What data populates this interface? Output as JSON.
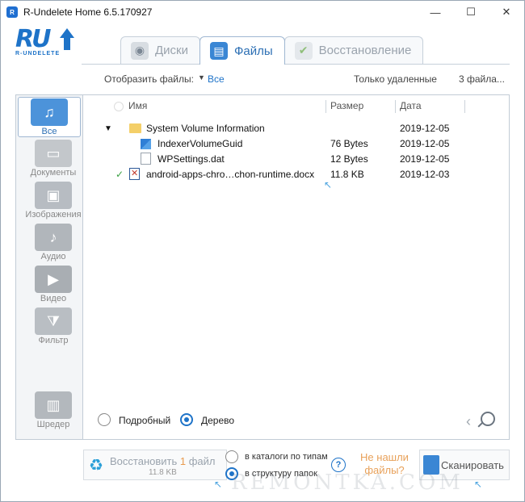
{
  "window": {
    "title": "R-Undelete Home 6.5.170927",
    "icon_text": "R",
    "controls": [
      "—",
      "☐",
      "✕"
    ]
  },
  "logo": {
    "mark": "RU",
    "subtext": "R-UNDELETE"
  },
  "tabs": [
    {
      "label": "Диски",
      "icon": "disk-icon",
      "active": false
    },
    {
      "label": "Файлы",
      "icon": "files-icon",
      "active": true
    },
    {
      "label": "Восстановление",
      "icon": "restore-icon",
      "active": false
    }
  ],
  "filterbar": {
    "show_label": "Отобразить файлы:",
    "caret": "▼",
    "show_value": "Все",
    "only_deleted": "Только удаленные",
    "count": "3 файла..."
  },
  "categories": [
    {
      "label": "Все",
      "icon": "all-files-icon"
    },
    {
      "label": "Документы",
      "icon": "documents-icon"
    },
    {
      "label": "Изображения",
      "icon": "images-icon"
    },
    {
      "label": "Аудио",
      "icon": "audio-icon"
    },
    {
      "label": "Видео",
      "icon": "video-icon"
    },
    {
      "label": "Фильтр",
      "icon": "filter-icon"
    },
    {
      "label": "Шредер",
      "icon": "shredder-icon"
    }
  ],
  "columns": {
    "name": "Имя",
    "size": "Размер",
    "date": "Дата"
  },
  "rows": [
    {
      "expander": "▼",
      "name": "System Volume Information",
      "size": "",
      "date": "2019-12-05"
    },
    {
      "name": "IndexerVolumeGuid",
      "size": "76 Bytes",
      "date": "2019-12-05"
    },
    {
      "name": "WPSettings.dat",
      "size": "12 Bytes",
      "date": "2019-12-05"
    },
    {
      "check": "✓",
      "name": "android-apps-chro…chon-runtime.docx",
      "size": "11.8 KB",
      "date": "2019-12-03"
    }
  ],
  "viewmode": {
    "detailed": "Подробный",
    "tree": "Дерево",
    "selected": "tree"
  },
  "restore": {
    "label_prefix": "Восстановить ",
    "count": "1",
    "label_suffix": " файл",
    "size": "11.8 KB",
    "dest_by_type": "в каталоги по типам",
    "dest_by_folder": "в структуру папок",
    "selected_dest": "folder"
  },
  "help": "?",
  "not_found": "Не нашли файлы?",
  "scan_label": "Сканировать",
  "watermark": "REMONTKA.COM",
  "colors": {
    "accent": "#1e73c8",
    "orange": "#e89a4d",
    "green_check": "#3aa042"
  }
}
